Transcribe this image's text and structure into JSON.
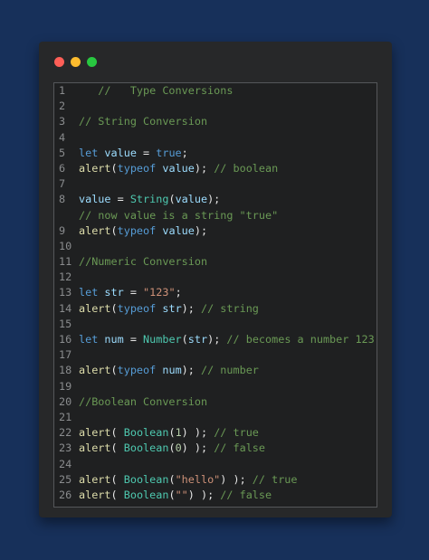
{
  "window": {
    "buttons": [
      "close",
      "minimize",
      "maximize"
    ]
  },
  "colors": {
    "background": "#17305a",
    "keyword": "#569cd6",
    "function": "#dcdcaa",
    "class": "#4ec9b0",
    "comment": "#6a9955",
    "string": "#ce9178",
    "number": "#b5cea8",
    "variable": "#9cdcfe"
  },
  "code": {
    "lines": [
      {
        "num": "1",
        "tokens": [
          {
            "t": "   //   Type Conversions",
            "c": "cm"
          }
        ]
      },
      {
        "num": "2",
        "tokens": []
      },
      {
        "num": "3",
        "tokens": [
          {
            "t": "// String Conversion",
            "c": "cm"
          }
        ]
      },
      {
        "num": "4",
        "tokens": []
      },
      {
        "num": "5",
        "tokens": [
          {
            "t": "let",
            "c": "kw"
          },
          {
            "t": " ",
            "c": "plain"
          },
          {
            "t": "value",
            "c": "var"
          },
          {
            "t": " = ",
            "c": "plain"
          },
          {
            "t": "true",
            "c": "kw"
          },
          {
            "t": ";",
            "c": "plain"
          }
        ]
      },
      {
        "num": "6",
        "tokens": [
          {
            "t": "alert",
            "c": "fn"
          },
          {
            "t": "(",
            "c": "plain"
          },
          {
            "t": "typeof",
            "c": "kw"
          },
          {
            "t": " ",
            "c": "plain"
          },
          {
            "t": "value",
            "c": "var"
          },
          {
            "t": "); ",
            "c": "plain"
          },
          {
            "t": "// boolean",
            "c": "cm"
          }
        ]
      },
      {
        "num": "7",
        "tokens": []
      },
      {
        "num": "8",
        "tokens": [
          {
            "t": "value",
            "c": "var"
          },
          {
            "t": " = ",
            "c": "plain"
          },
          {
            "t": "String",
            "c": "cls"
          },
          {
            "t": "(",
            "c": "plain"
          },
          {
            "t": "value",
            "c": "var"
          },
          {
            "t": ");",
            "c": "plain"
          }
        ]
      },
      {
        "num": "",
        "tokens": [
          {
            "t": "// now value is a string \"true\"",
            "c": "cm"
          }
        ]
      },
      {
        "num": "9",
        "tokens": [
          {
            "t": "alert",
            "c": "fn"
          },
          {
            "t": "(",
            "c": "plain"
          },
          {
            "t": "typeof",
            "c": "kw"
          },
          {
            "t": " ",
            "c": "plain"
          },
          {
            "t": "value",
            "c": "var"
          },
          {
            "t": ");",
            "c": "plain"
          }
        ]
      },
      {
        "num": "10",
        "tokens": []
      },
      {
        "num": "11",
        "tokens": [
          {
            "t": "//Numeric Conversion",
            "c": "cm"
          }
        ]
      },
      {
        "num": "12",
        "tokens": []
      },
      {
        "num": "13",
        "tokens": [
          {
            "t": "let",
            "c": "kw"
          },
          {
            "t": " ",
            "c": "plain"
          },
          {
            "t": "str",
            "c": "var"
          },
          {
            "t": " = ",
            "c": "plain"
          },
          {
            "t": "\"123\"",
            "c": "str"
          },
          {
            "t": ";",
            "c": "plain"
          }
        ]
      },
      {
        "num": "14",
        "tokens": [
          {
            "t": "alert",
            "c": "fn"
          },
          {
            "t": "(",
            "c": "plain"
          },
          {
            "t": "typeof",
            "c": "kw"
          },
          {
            "t": " ",
            "c": "plain"
          },
          {
            "t": "str",
            "c": "var"
          },
          {
            "t": "); ",
            "c": "plain"
          },
          {
            "t": "// string",
            "c": "cm"
          }
        ]
      },
      {
        "num": "15",
        "tokens": []
      },
      {
        "num": "16",
        "tokens": [
          {
            "t": "let",
            "c": "kw"
          },
          {
            "t": " ",
            "c": "plain"
          },
          {
            "t": "num",
            "c": "var"
          },
          {
            "t": " = ",
            "c": "plain"
          },
          {
            "t": "Number",
            "c": "cls"
          },
          {
            "t": "(",
            "c": "plain"
          },
          {
            "t": "str",
            "c": "var"
          },
          {
            "t": "); ",
            "c": "plain"
          },
          {
            "t": "// becomes a number 123",
            "c": "cm"
          }
        ]
      },
      {
        "num": "17",
        "tokens": []
      },
      {
        "num": "18",
        "tokens": [
          {
            "t": "alert",
            "c": "fn"
          },
          {
            "t": "(",
            "c": "plain"
          },
          {
            "t": "typeof",
            "c": "kw"
          },
          {
            "t": " ",
            "c": "plain"
          },
          {
            "t": "num",
            "c": "var"
          },
          {
            "t": "); ",
            "c": "plain"
          },
          {
            "t": "// number",
            "c": "cm"
          }
        ]
      },
      {
        "num": "19",
        "tokens": []
      },
      {
        "num": "20",
        "tokens": [
          {
            "t": "//Boolean Conversion",
            "c": "cm"
          }
        ]
      },
      {
        "num": "21",
        "tokens": []
      },
      {
        "num": "22",
        "tokens": [
          {
            "t": "alert",
            "c": "fn"
          },
          {
            "t": "( ",
            "c": "plain"
          },
          {
            "t": "Boolean",
            "c": "cls"
          },
          {
            "t": "(",
            "c": "plain"
          },
          {
            "t": "1",
            "c": "num"
          },
          {
            "t": ") ); ",
            "c": "plain"
          },
          {
            "t": "// true",
            "c": "cm"
          }
        ]
      },
      {
        "num": "23",
        "tokens": [
          {
            "t": "alert",
            "c": "fn"
          },
          {
            "t": "( ",
            "c": "plain"
          },
          {
            "t": "Boolean",
            "c": "cls"
          },
          {
            "t": "(",
            "c": "plain"
          },
          {
            "t": "0",
            "c": "num"
          },
          {
            "t": ") ); ",
            "c": "plain"
          },
          {
            "t": "// false",
            "c": "cm"
          }
        ]
      },
      {
        "num": "24",
        "tokens": []
      },
      {
        "num": "25",
        "tokens": [
          {
            "t": "alert",
            "c": "fn"
          },
          {
            "t": "( ",
            "c": "plain"
          },
          {
            "t": "Boolean",
            "c": "cls"
          },
          {
            "t": "(",
            "c": "plain"
          },
          {
            "t": "\"hello\"",
            "c": "str"
          },
          {
            "t": ") ); ",
            "c": "plain"
          },
          {
            "t": "// true",
            "c": "cm"
          }
        ]
      },
      {
        "num": "26",
        "tokens": [
          {
            "t": "alert",
            "c": "fn"
          },
          {
            "t": "( ",
            "c": "plain"
          },
          {
            "t": "Boolean",
            "c": "cls"
          },
          {
            "t": "(",
            "c": "plain"
          },
          {
            "t": "\"\"",
            "c": "str"
          },
          {
            "t": ") ); ",
            "c": "plain"
          },
          {
            "t": "// false",
            "c": "cm"
          }
        ]
      }
    ]
  }
}
